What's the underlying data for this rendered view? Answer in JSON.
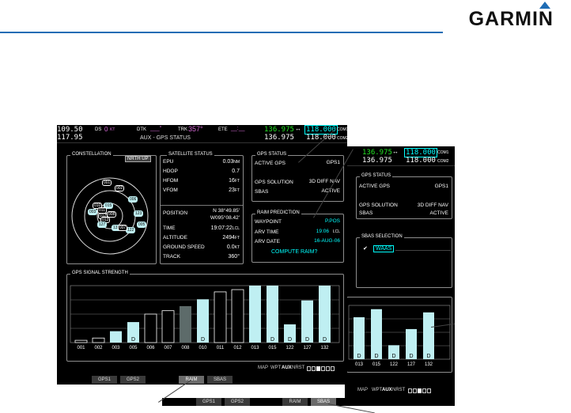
{
  "brand": {
    "name": "GARMIN"
  },
  "main": {
    "topbar": {
      "nav1": "109.50",
      "nav2": "117.95",
      "ds_label": "DS",
      "ds_value": "0",
      "ds_unit": "KT",
      "dtk_label": "DTK",
      "dtk_value": "___°",
      "trk_label": "TRK",
      "trk_value": "357°",
      "ete_label": "ETE",
      "ete_value": "__:__",
      "com1_active": "136.975",
      "swap": "↔",
      "com1_standby": "118.000",
      "com1_label": "COM1",
      "com2_active": "136.975",
      "com2_standby": "118.000",
      "com2_label": "COM2",
      "page_title": "AUX - GPS STATUS"
    },
    "constellation": {
      "title": "CONSTELLATION",
      "orient_button": "NRTH UP",
      "sats": [
        {
          "id": "001",
          "cy": false
        },
        {
          "id": "002",
          "cy": false
        },
        {
          "id": "006",
          "cy": true
        },
        {
          "id": "123",
          "cy": true
        },
        {
          "id": "005",
          "cy": true
        },
        {
          "id": "010",
          "cy": false
        },
        {
          "id": "015",
          "cy": true
        },
        {
          "id": "011",
          "cy": false
        },
        {
          "id": "012",
          "cy": false
        },
        {
          "id": "013",
          "cy": false
        },
        {
          "id": "122",
          "cy": true
        },
        {
          "id": "127",
          "cy": true
        },
        {
          "id": "132",
          "cy": true
        },
        {
          "id": "007",
          "cy": false
        },
        {
          "id": "003",
          "cy": true
        },
        {
          "id": "008",
          "cy": false
        }
      ]
    },
    "satellite_status": {
      "title": "SATELLITE STATUS",
      "rows": [
        {
          "label": "EPU",
          "value": "0.03",
          "unit": "NM"
        },
        {
          "label": "HDOP",
          "value": "0.7",
          "unit": ""
        },
        {
          "label": "HFOM",
          "value": "16",
          "unit": "FT"
        },
        {
          "label": "VFOM",
          "value": "23",
          "unit": "FT"
        }
      ],
      "position_label": "POSITION",
      "position_lat": "N 38°49.85'",
      "position_lon": "W095°08.42'",
      "rows2": [
        {
          "label": "TIME",
          "value": "19:07:22",
          "unit": "LCL"
        },
        {
          "label": "ALTITUDE",
          "value": "2494",
          "unit": "FT"
        },
        {
          "label": "GROUND SPEED",
          "value": "0.0",
          "unit": "KT"
        },
        {
          "label": "TRACK",
          "value": "360°",
          "unit": ""
        }
      ]
    },
    "gps_status": {
      "title": "GPS STATUS",
      "active_gps_label": "ACTIVE GPS",
      "active_gps_value": "GPS1",
      "solution_label": "GPS SOLUTION",
      "solution_value": "3D DIFF NAV",
      "sbas_label": "SBAS",
      "sbas_value": "ACTIVE"
    },
    "raim": {
      "title": "RAIM PREDICTION",
      "waypoint_label": "WAYPOINT",
      "waypoint_value": "P.POS",
      "arv_time_label": "ARV TIME",
      "arv_time_value": "19:06",
      "arv_time_unit": "LCL",
      "arv_date_label": "ARV DATE",
      "arv_date_value": "16-AUG-06",
      "compute_button": "COMPUTE RAIM?"
    },
    "signal": {
      "title": "GPS SIGNAL STRENGTH"
    },
    "mode_bar": {
      "labels": [
        "MAP",
        "WPT",
        "AUX",
        "NRST"
      ]
    },
    "softkeys": {
      "gps1": "GPS1",
      "gps2": "GPS2",
      "raim": "RAIM",
      "sbas": "SBAS"
    }
  },
  "back": {
    "topbar": {
      "com1_active": "136.975",
      "swap": "↔",
      "com1_standby": "118.000",
      "com1_label": "COM1",
      "com2_active": "136.975",
      "com2_standby": "118.000",
      "com2_label": "COM2"
    },
    "gps_status": {
      "title": "GPS STATUS",
      "active_gps_label": "ACTIVE GPS",
      "active_gps_value": "GPS1",
      "solution_label": "GPS SOLUTION",
      "solution_value": "3D DIFF NAV",
      "sbas_label": "SBAS",
      "sbas_value": "ACTIVE"
    },
    "sbas_selection": {
      "title": "SBAS SELECTION",
      "check": "✔",
      "waas": "WAAS"
    },
    "mode_bar": {
      "labels": [
        "MAP",
        "WPT",
        "AUX",
        "NRST"
      ]
    },
    "softkeys": {
      "gps1": "GPS1",
      "gps2": "GPS2",
      "raim": "RAIM",
      "sbas": "SBAS"
    }
  },
  "chart_data": [
    {
      "type": "bar",
      "title": "GPS SIGNAL STRENGTH",
      "categories": [
        "001",
        "002",
        "003",
        "005",
        "006",
        "007",
        "008",
        "010",
        "011",
        "012",
        "013",
        "015",
        "122",
        "127",
        "132"
      ],
      "values": [
        4,
        8,
        20,
        36,
        50,
        56,
        64,
        76,
        89,
        93,
        100,
        100,
        32,
        74,
        100
      ],
      "differential": [
        false,
        false,
        false,
        true,
        false,
        false,
        false,
        true,
        false,
        false,
        false,
        true,
        true,
        true,
        true
      ],
      "color_state": [
        "white",
        "white",
        "cyan",
        "cyan",
        "white",
        "white",
        "gray",
        "cyan",
        "white",
        "white",
        "cyan",
        "cyan",
        "cyan",
        "cyan",
        "cyan"
      ],
      "ylim": [
        0,
        100
      ]
    },
    {
      "type": "bar",
      "categories": [
        "013",
        "015",
        "122",
        "127",
        "132"
      ],
      "values": [
        78,
        93,
        26,
        56,
        87
      ],
      "differential": [
        true,
        true,
        true,
        true,
        true
      ],
      "color_state": [
        "cyan",
        "cyan",
        "cyan",
        "cyan",
        "cyan"
      ],
      "ylim": [
        0,
        100
      ]
    }
  ]
}
